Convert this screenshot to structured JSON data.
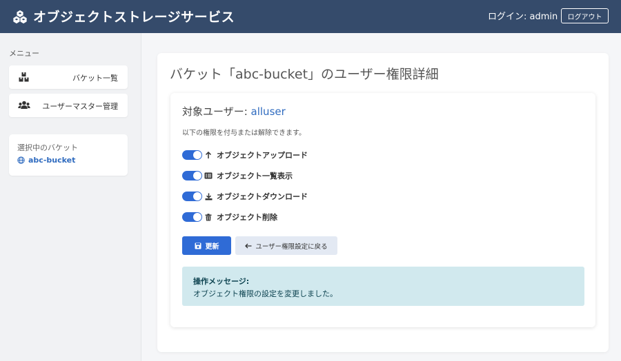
{
  "header": {
    "title": "オブジェクトストレージサービス",
    "logo_icon": "cubes-icon",
    "login_text": "ログイン: admin",
    "logout_label": "ログアウト",
    "bg_color": "#354b6b"
  },
  "sidebar": {
    "menu_label": "メニュー",
    "items": [
      {
        "label": "バケット一覧",
        "icon": "boxes-icon"
      },
      {
        "label": "ユーザーマスター管理",
        "icon": "users-icon"
      }
    ],
    "selected_bucket": {
      "title": "選択中のバケット",
      "name": "abc-bucket",
      "icon": "globe-icon"
    }
  },
  "main": {
    "page_title": "バケット「abc-bucket」のユーザー権限詳細",
    "target_label": "対象ユーザー: ",
    "target_user": "alluser",
    "description": "以下の権限を付与または解除できます。",
    "permissions": [
      {
        "label": "オブジェクトアップロード",
        "icon": "arrow-up-icon",
        "enabled": true
      },
      {
        "label": "オブジェクト一覧表示",
        "icon": "list-icon",
        "enabled": true
      },
      {
        "label": "オブジェクトダウンロード",
        "icon": "download-icon",
        "enabled": true
      },
      {
        "label": "オブジェクト削除",
        "icon": "trash-icon",
        "enabled": true
      }
    ],
    "update_label": "更新",
    "back_label": "ユーザー権限設定に戻る",
    "alert": {
      "heading": "操作メッセージ:",
      "message": "オブジェクト権限の設定を変更しました。"
    },
    "accent_color": "#2f6bd6"
  }
}
